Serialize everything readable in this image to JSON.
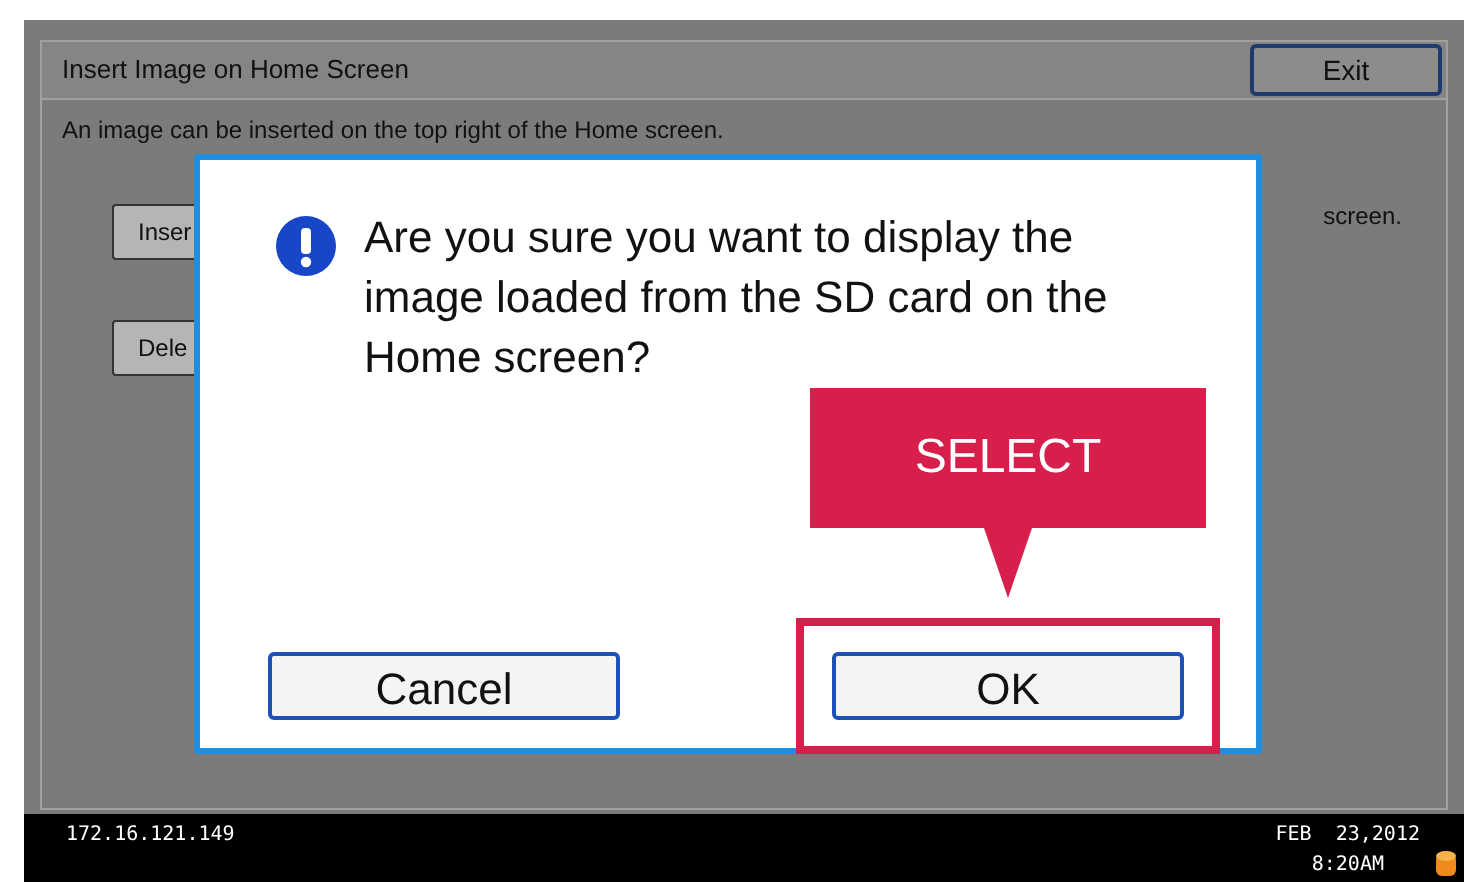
{
  "screen": {
    "title": "Insert Image on Home Screen",
    "exit_button": "Exit",
    "description": "An image can be inserted on the top right of the Home screen.",
    "buttons": [
      "Inser",
      "Dele"
    ],
    "side_text": "screen."
  },
  "dialog": {
    "message": "Are you sure you want to display the image loaded from the SD card on the Home screen?",
    "buttons": [
      {
        "label": "Cancel",
        "highlighted": false
      },
      {
        "label": "OK",
        "highlighted": true
      }
    ]
  },
  "callout": {
    "text": "SELECT"
  },
  "status_bar": {
    "ip": "172.16.121.149",
    "date": "FEB  23,2012",
    "time": "8:20AM"
  }
}
